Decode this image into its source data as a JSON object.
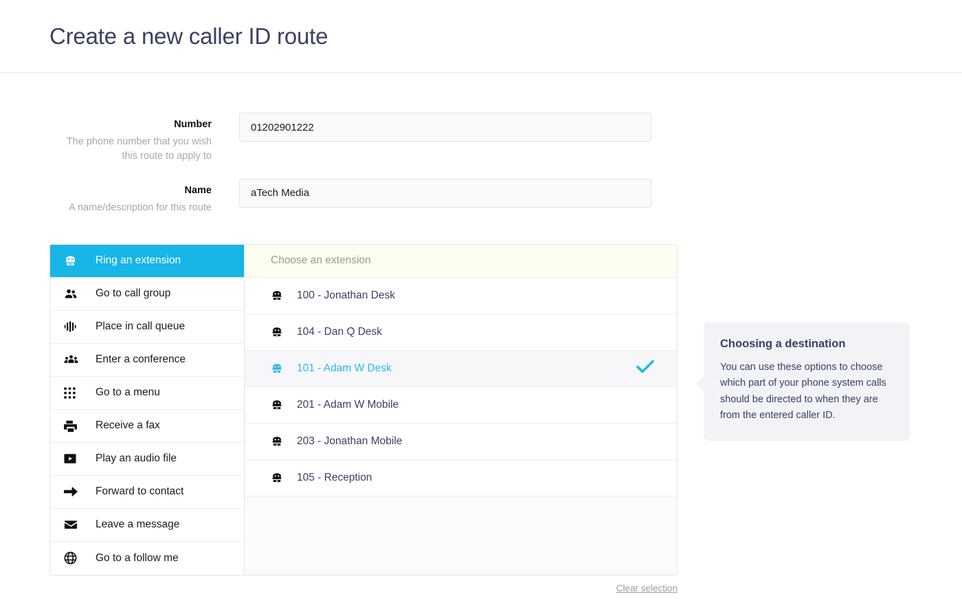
{
  "header": {
    "title": "Create a new caller ID route"
  },
  "form": {
    "fields": [
      {
        "label": "Number",
        "help": "The phone number that you wish this route to apply to",
        "value": "01202901222",
        "placeholder": ""
      },
      {
        "label": "Name",
        "help": "A name/description for this route",
        "value": "aTech Media",
        "placeholder": ""
      }
    ]
  },
  "destination": {
    "options": [
      {
        "label": "Ring an extension",
        "icon": "telephone-icon",
        "active": true
      },
      {
        "label": "Go to call group",
        "icon": "users-icon",
        "active": false
      },
      {
        "label": "Place in call queue",
        "icon": "signal-bars-icon",
        "active": false
      },
      {
        "label": "Enter a conference",
        "icon": "conference-icon",
        "active": false
      },
      {
        "label": "Go to a menu",
        "icon": "grid-dots-icon",
        "active": false
      },
      {
        "label": "Receive a fax",
        "icon": "fax-icon",
        "active": false
      },
      {
        "label": "Play an audio file",
        "icon": "play-icon",
        "active": false
      },
      {
        "label": "Forward to contact",
        "icon": "arrow-right-icon",
        "active": false
      },
      {
        "label": "Leave a message",
        "icon": "envelope-icon",
        "active": false
      },
      {
        "label": "Go to a follow me",
        "icon": "globe-icon",
        "active": false
      }
    ],
    "list_header": "Choose an extension",
    "extensions": [
      {
        "label": "100 - Jonathan Desk",
        "selected": false
      },
      {
        "label": "104 - Dan Q Desk",
        "selected": false
      },
      {
        "label": "101 - Adam W Desk",
        "selected": true
      },
      {
        "label": "201 - Adam W Mobile",
        "selected": false
      },
      {
        "label": "203 - Jonathan Mobile",
        "selected": false
      },
      {
        "label": "105 - Reception",
        "selected": false
      }
    ],
    "clear_label": "Clear selection"
  },
  "callout": {
    "title": "Choosing a destination",
    "text": "You can use these options to choose which part of your phone system calls should be directed to when they are from the entered caller ID."
  },
  "colors": {
    "accent": "#18b5e7",
    "title": "#3b4063",
    "check": "#1fb8e8",
    "header_bg": "#fdfdf2"
  }
}
